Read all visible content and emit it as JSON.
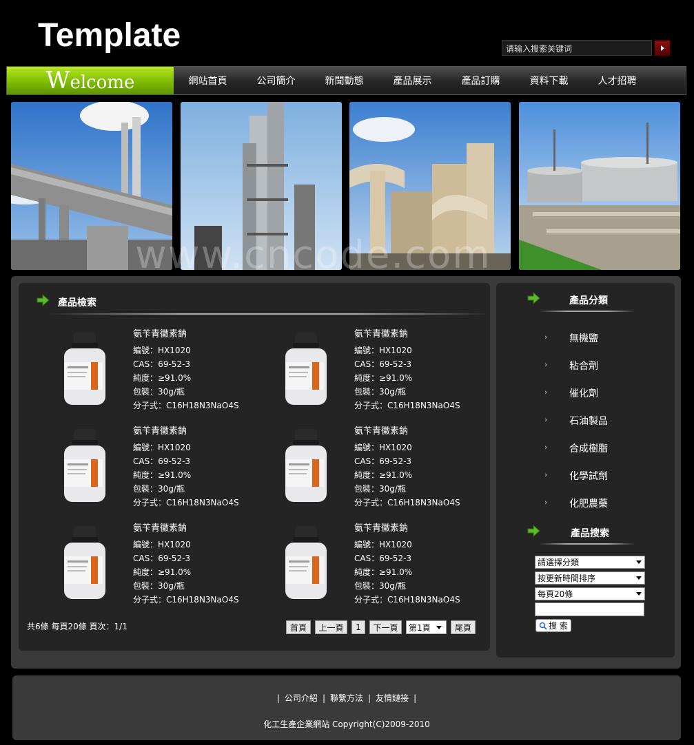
{
  "header": {
    "logo": "Template",
    "search_placeholder": "请输入搜索关键词"
  },
  "nav": {
    "welcome": "Welcome",
    "items": [
      "網站首頁",
      "公司簡介",
      "新聞動態",
      "產品展示",
      "產品訂購",
      "資料下載",
      "人才招聘"
    ]
  },
  "banner": {
    "watermark": "www.cncode.com"
  },
  "products_section": {
    "title": "產品檢索",
    "items": [
      {
        "name": "氨苄青黴素鈉",
        "code": "編號：HX1020",
        "cas": "CAS：69-52-3",
        "purity": "純度：≥91.0%",
        "package": "包裝：30g/瓶",
        "formula": "分子式：C16H18N3NaO4S"
      },
      {
        "name": "氨苄青黴素鈉",
        "code": "編號：HX1020",
        "cas": "CAS：69-52-3",
        "purity": "純度：≥91.0%",
        "package": "包裝：30g/瓶",
        "formula": "分子式：C16H18N3NaO4S"
      },
      {
        "name": "氨苄青黴素鈉",
        "code": "編號：HX1020",
        "cas": "CAS：69-52-3",
        "purity": "純度：≥91.0%",
        "package": "包裝：30g/瓶",
        "formula": "分子式：C16H18N3NaO4S"
      },
      {
        "name": "氨苄青黴素鈉",
        "code": "編號：HX1020",
        "cas": "CAS：69-52-3",
        "purity": "純度：≥91.0%",
        "package": "包裝：30g/瓶",
        "formula": "分子式：C16H18N3NaO4S"
      },
      {
        "name": "氨苄青黴素鈉",
        "code": "編號：HX1020",
        "cas": "CAS：69-52-3",
        "purity": "純度：≥91.0%",
        "package": "包裝：30g/瓶",
        "formula": "分子式：C16H18N3NaO4S"
      },
      {
        "name": "氨苄青黴素鈉",
        "code": "編號：HX1020",
        "cas": "CAS：69-52-3",
        "purity": "純度：≥91.0%",
        "package": "包裝：30g/瓶",
        "formula": "分子式：C16H18N3NaO4S"
      }
    ]
  },
  "pager": {
    "summary": "共6條 每頁20條 頁次：1/1",
    "first": "首頁",
    "prev": "上一頁",
    "current": "1",
    "next": "下一頁",
    "page_select": "第1頁",
    "last": "尾頁"
  },
  "categories": {
    "title": "產品分類",
    "items": [
      "無機鹽",
      "粘合劑",
      "催化劑",
      "石油製品",
      "合成樹脂",
      "化學試劑",
      "化肥農藥"
    ]
  },
  "product_search": {
    "title": "產品搜索",
    "category_select": "請選擇分類",
    "sort_select": "按更新時間排序",
    "per_page_select": "每頁20條",
    "button": "搜 索"
  },
  "footer": {
    "links": [
      "公司介紹",
      "聯繫方法",
      "友情鏈接"
    ],
    "copyright": "化工生產企業網站 Copyright(C)2009-2010"
  },
  "colors": {
    "welcome_green": "#7fbc04",
    "panel_bg": "#242424",
    "outer_bg": "#3a3a3a",
    "search_go": "#8b1010"
  }
}
